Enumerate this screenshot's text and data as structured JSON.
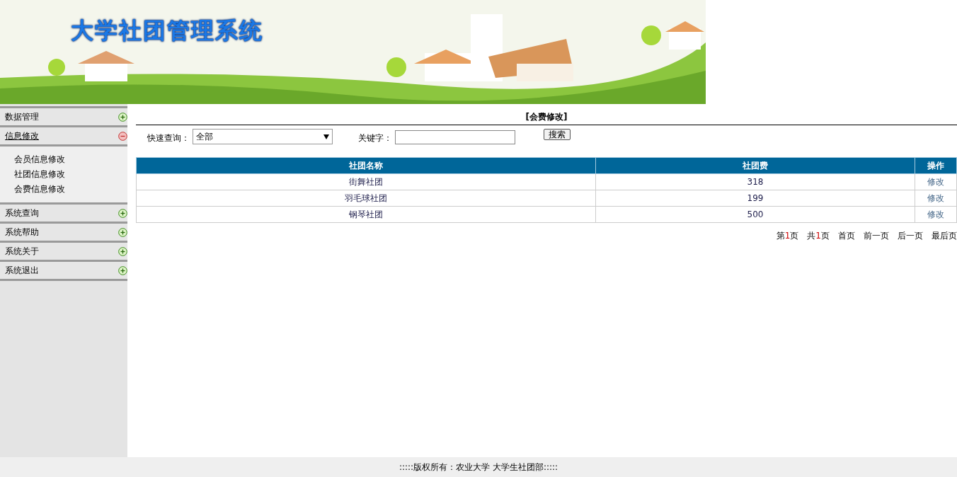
{
  "header": {
    "title": "大学社团管理系统"
  },
  "sidebar": {
    "groups": [
      {
        "label": "数据管理",
        "expanded": false
      },
      {
        "label": "信息修改",
        "expanded": true,
        "items": [
          "会员信息修改",
          "社团信息修改",
          "会费信息修改"
        ]
      },
      {
        "label": "系统查询",
        "expanded": false
      },
      {
        "label": "系统帮助",
        "expanded": false
      },
      {
        "label": "系统关于",
        "expanded": false
      },
      {
        "label": "系统退出",
        "expanded": false
      }
    ]
  },
  "content": {
    "title": "[会费修改]",
    "filter": {
      "quick_label": "快速查询：",
      "quick_value": "全部",
      "keyword_label": "关键字：",
      "search_button": "搜索"
    },
    "table": {
      "columns": [
        "社团名称",
        "社团费",
        "操作"
      ],
      "rows": [
        {
          "name": "街舞社团",
          "fee": "318",
          "action": "修改"
        },
        {
          "name": "羽毛球社团",
          "fee": "199",
          "action": "修改"
        },
        {
          "name": "钢琴社团",
          "fee": "500",
          "action": "修改"
        }
      ]
    },
    "pager": {
      "info": [
        {
          "before": "第",
          "number": "1",
          "after": "页"
        },
        {
          "before": "共",
          "number": "1",
          "after": "页"
        }
      ],
      "links": [
        "首页",
        "前一页",
        "后一页",
        "最后页"
      ]
    }
  },
  "footer": ":::::版权所有：农业大学 大学生社团部:::::"
}
